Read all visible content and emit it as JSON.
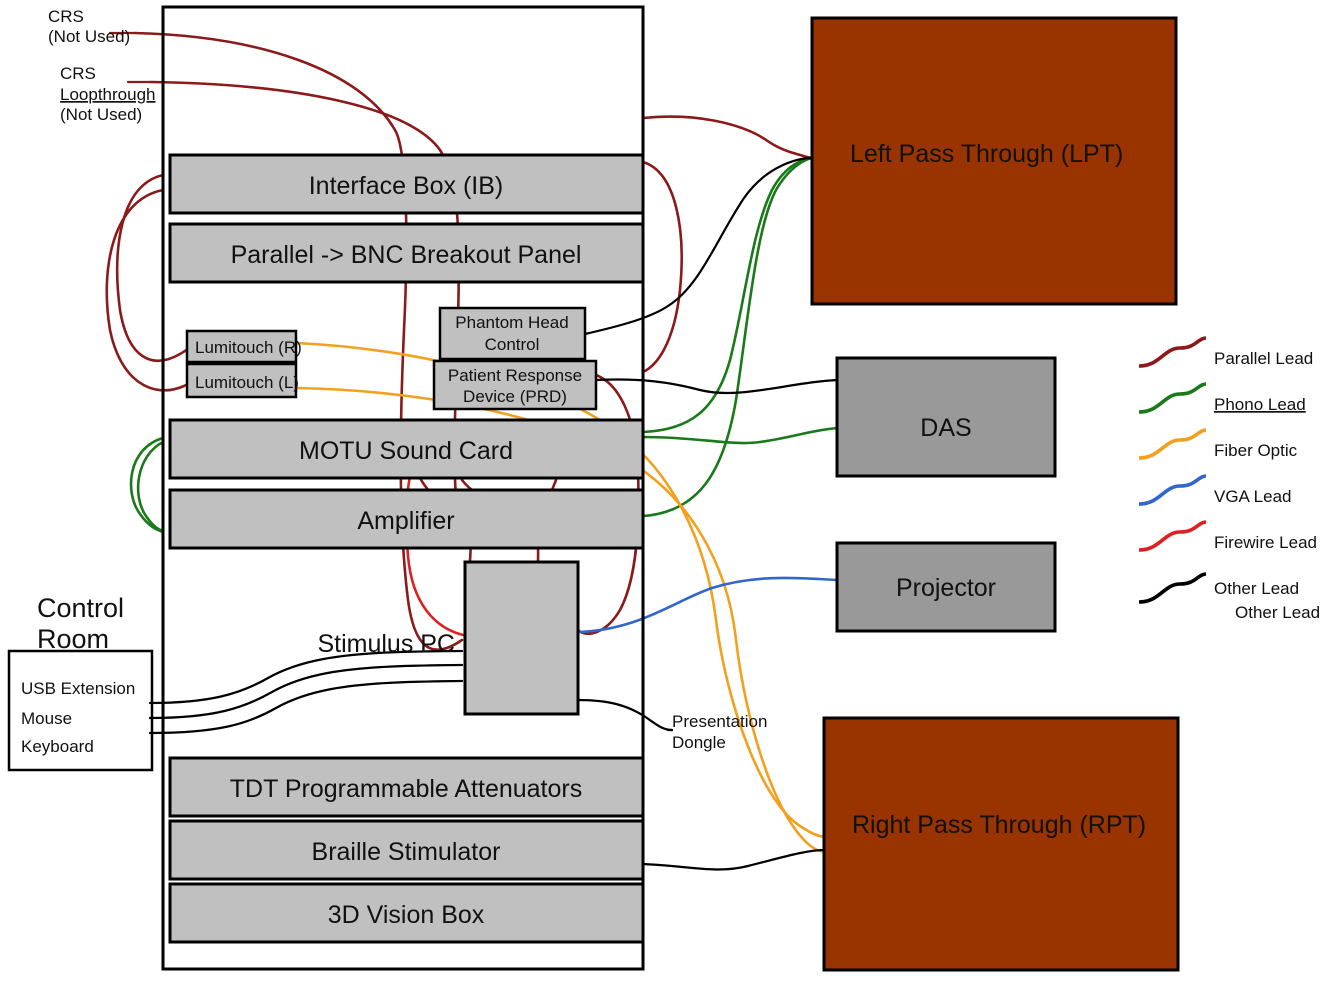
{
  "colors": {
    "parallel_lead": "#8B1A1A",
    "phono_lead": "#1A7A1A",
    "fiber_optic": "#F2A01E",
    "vga_lead": "#3366CC",
    "firewire_lead": "#E02020",
    "other_lead": "#000000",
    "rack_unit_fill": "#C0C0C0",
    "device_fill": "#999999",
    "pass_through_fill": "#993300",
    "outline": "#000000",
    "page_background": "#FFFFFF"
  },
  "annotations": {
    "crs": "CRS",
    "crs_not_used": "(Not Used)",
    "crs_loopthrough_1": "CRS",
    "crs_loopthrough_2": "Loopthrough",
    "crs_loopthrough_3": "(Not Used)",
    "control_room_1": "Control",
    "control_room_2": "Room",
    "stimulus_pc": "Stimulus PC",
    "presentation_dongle_1": "Presentation",
    "presentation_dongle_2": "Dongle"
  },
  "rack": {
    "units": [
      {
        "id": "interface-box",
        "label": "Interface Box (IB)"
      },
      {
        "id": "bnc-breakout",
        "label": "Parallel -> BNC Breakout Panel"
      },
      {
        "id": "motu-sound-card",
        "label": "MOTU Sound Card"
      },
      {
        "id": "amplifier",
        "label": "Amplifier"
      },
      {
        "id": "tdt-attenuators",
        "label": "TDT Programmable Attenuators"
      },
      {
        "id": "braille-stimulator",
        "label": "Braille Stimulator"
      },
      {
        "id": "3d-vision-box",
        "label": "3D Vision Box"
      }
    ],
    "small_units": [
      {
        "id": "lumitouch-r",
        "label": "Lumitouch (R)"
      },
      {
        "id": "lumitouch-l",
        "label": "Lumitouch (L)"
      },
      {
        "id": "phantom-head-control",
        "label_line1": "Phantom Head",
        "label_line2": "Control"
      },
      {
        "id": "patient-response-device",
        "label_line1": "Patient Response",
        "label_line2": "Device (PRD)"
      }
    ]
  },
  "control_room": {
    "cables": [
      {
        "id": "usb-extension",
        "label": "USB Extension"
      },
      {
        "id": "mouse",
        "label": "Mouse"
      },
      {
        "id": "keyboard",
        "label": "Keyboard"
      }
    ]
  },
  "devices": [
    {
      "id": "left-pass-through",
      "label": "Left Pass Through (LPT)",
      "kind": "pass-through"
    },
    {
      "id": "das",
      "label": "DAS",
      "kind": "device"
    },
    {
      "id": "projector",
      "label": "Projector",
      "kind": "device"
    },
    {
      "id": "right-pass-through",
      "label": "Right Pass Through (RPT)",
      "kind": "pass-through"
    }
  ],
  "legend": {
    "entries": [
      {
        "id": "parallel-lead",
        "label": "Parallel Lead",
        "color": "#8B1A1A",
        "spellcheck": false
      },
      {
        "id": "phono-lead",
        "label": "Phono Lead",
        "color": "#1A7A1A",
        "spellcheck": true
      },
      {
        "id": "fiber-optic",
        "label": "Fiber Optic",
        "color": "#F2A01E",
        "spellcheck": false
      },
      {
        "id": "vga-lead",
        "label": "VGA Lead",
        "color": "#3366CC",
        "spellcheck": false
      },
      {
        "id": "firewire-lead",
        "label": "Firewire Lead",
        "color": "#E02020",
        "spellcheck": false
      },
      {
        "id": "other-lead",
        "label": "Other Lead",
        "color": "#000000",
        "spellcheck": false
      }
    ],
    "extra_label": "Other Lead"
  }
}
